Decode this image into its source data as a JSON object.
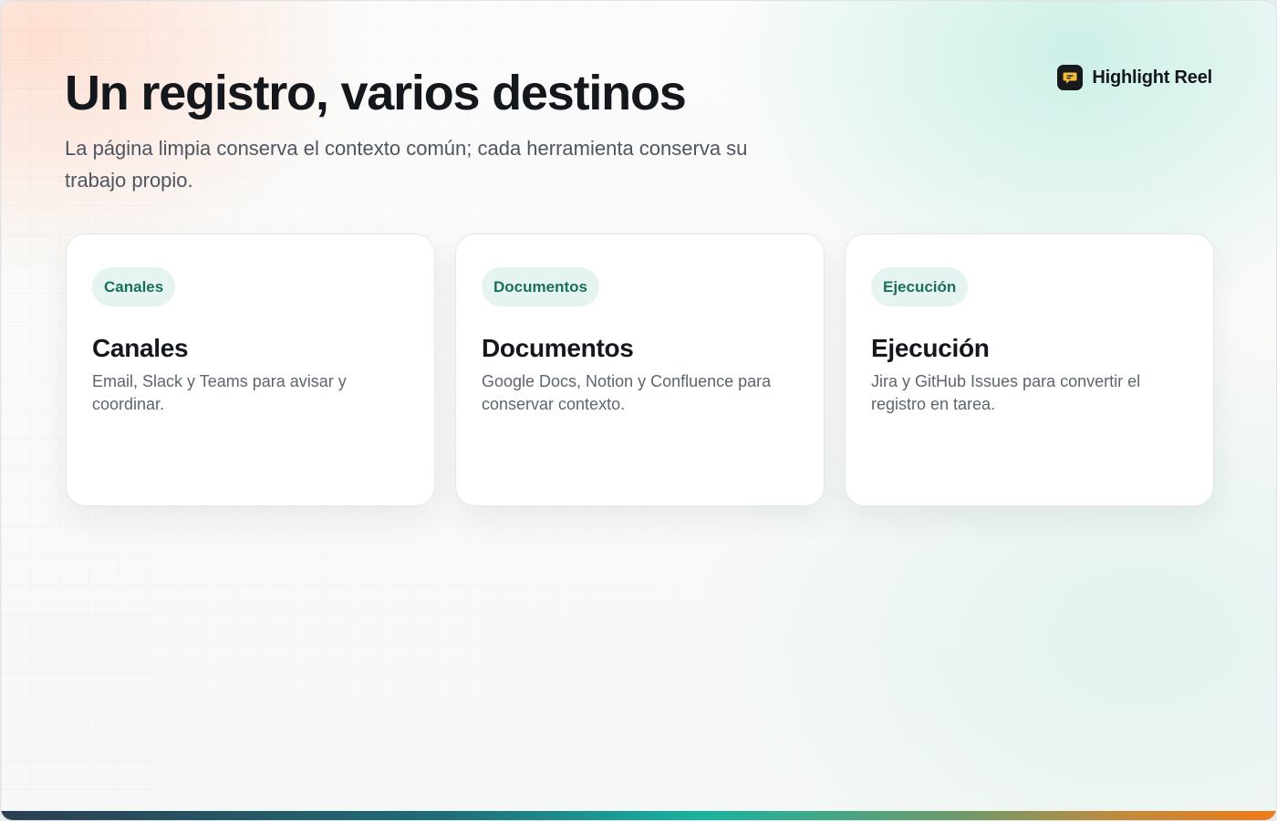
{
  "header": {
    "title": "Un registro, varios destinos",
    "subtitle": "La página limpia conserva el contexto común; cada herramienta conserva su trabajo propio."
  },
  "brand": {
    "name": "Highlight Reel",
    "icon": "chat-bubble-icon",
    "icon_bg": "#17191c",
    "icon_accent": "#f5b93a"
  },
  "cards": [
    {
      "chip": "Canales",
      "title": "Canales",
      "text": "Email, Slack y Teams para avisar y coordinar."
    },
    {
      "chip": "Documentos",
      "title": "Documentos",
      "text": "Google Docs, Notion y Confluence para conservar contexto."
    },
    {
      "chip": "Ejecución",
      "title": "Ejecución",
      "text": "Jira y GitHub Issues para convertir el registro en tarea."
    }
  ],
  "colors": {
    "chip_bg": "#e5f4f0",
    "chip_text": "#1b6e5e",
    "title": "#14171c",
    "body_text": "#5d6570"
  }
}
